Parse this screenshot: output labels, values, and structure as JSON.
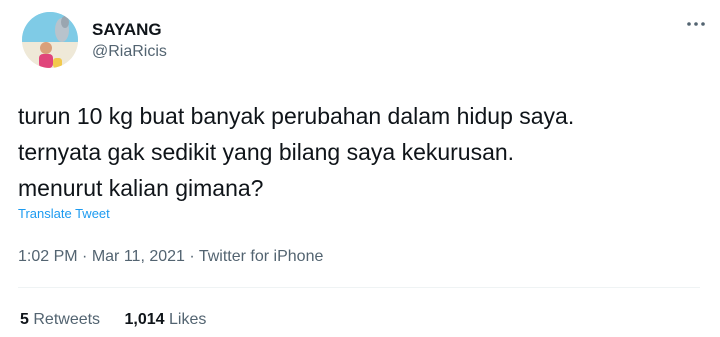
{
  "user": {
    "display_name": "SAYANG",
    "handle": "@RiaRicis"
  },
  "more_icon": "more-horizontal-icon",
  "tweet": {
    "lines": [
      "turun 10 kg buat banyak perubahan dalam hidup saya.",
      "ternyata gak sedikit yang bilang saya kekurusan.",
      "menurut kalian gimana?"
    ],
    "translate_label": "Translate Tweet",
    "time": "1:02 PM",
    "separator": "·",
    "date": "Mar 11, 2021",
    "source": "Twitter for iPhone"
  },
  "stats": {
    "retweets_count": "5",
    "retweets_label": "Retweets",
    "likes_count": "1,014",
    "likes_label": "Likes"
  },
  "colors": {
    "link": "#1d9bf0",
    "secondary_text": "#536471",
    "primary_text": "#0f1419"
  }
}
